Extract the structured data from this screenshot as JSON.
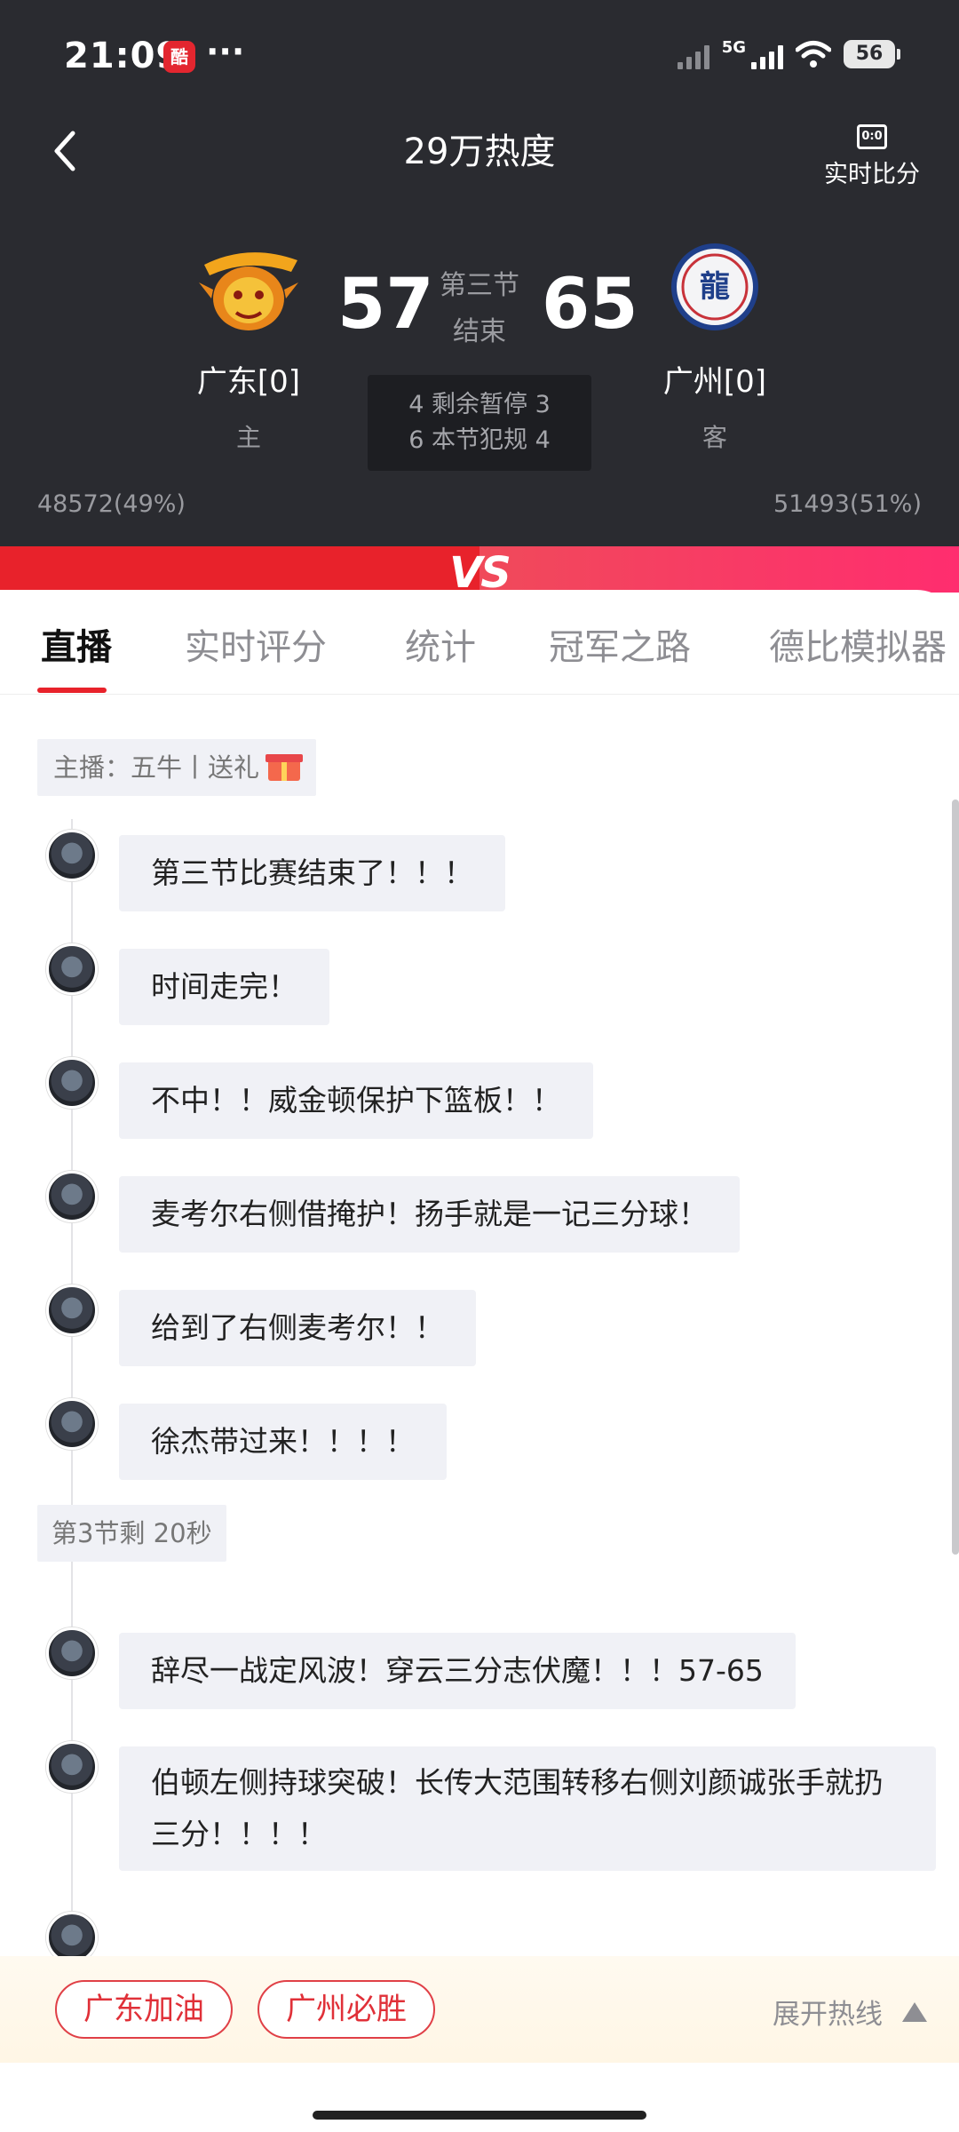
{
  "status_bar": {
    "time": "21:09",
    "app_icon_label": "酷",
    "more": "···",
    "network": "5G",
    "battery": "56"
  },
  "nav": {
    "title": "29万热度",
    "live_score_label": "实时比分",
    "live_score_icon_text": "0:0"
  },
  "match": {
    "home": {
      "name": "广东[0]",
      "side": "主",
      "score": "57",
      "support": "48572(49%)",
      "logo_color": "#f2a51c"
    },
    "away": {
      "name": "广州[0]",
      "side": "客",
      "score": "65",
      "support": "51493(51%)",
      "logo_color": "#1f3f8a"
    },
    "period": "第三节",
    "period_status": "结束",
    "stats_line1": "4 剩余暂停 3",
    "stats_line2": "6 本节犯规 4"
  },
  "vs_text": "VS",
  "tabs": [
    "直播",
    "实时评分",
    "统计",
    "冠军之路",
    "德比模拟器"
  ],
  "feed": {
    "host": "主播：五牛丨送礼",
    "messages_group1": [
      "第三节比赛结束了！！！",
      "时间走完！",
      "不中！！威金顿保护下篮板！！",
      "麦考尔右侧借掩护！扬手就是一记三分球！",
      "给到了右侧麦考尔！！",
      "徐杰带过来！！！！"
    ],
    "period_marker": "第3节剩 20秒",
    "messages_group2": [
      "辞尽一战定风波！穿云三分志伏魔！！！57-65",
      "伯顿左侧持球突破！长传大范围转移右侧刘颜诚张手就扔三分！！！！"
    ]
  },
  "cheer": {
    "home_button": "广东加油",
    "away_button": "广州必胜",
    "expand_label": "展开热线"
  },
  "colors": {
    "accent_red": "#e8222b",
    "header_bg": "#2a2b30",
    "bubble_bg": "#f0f1f6"
  }
}
